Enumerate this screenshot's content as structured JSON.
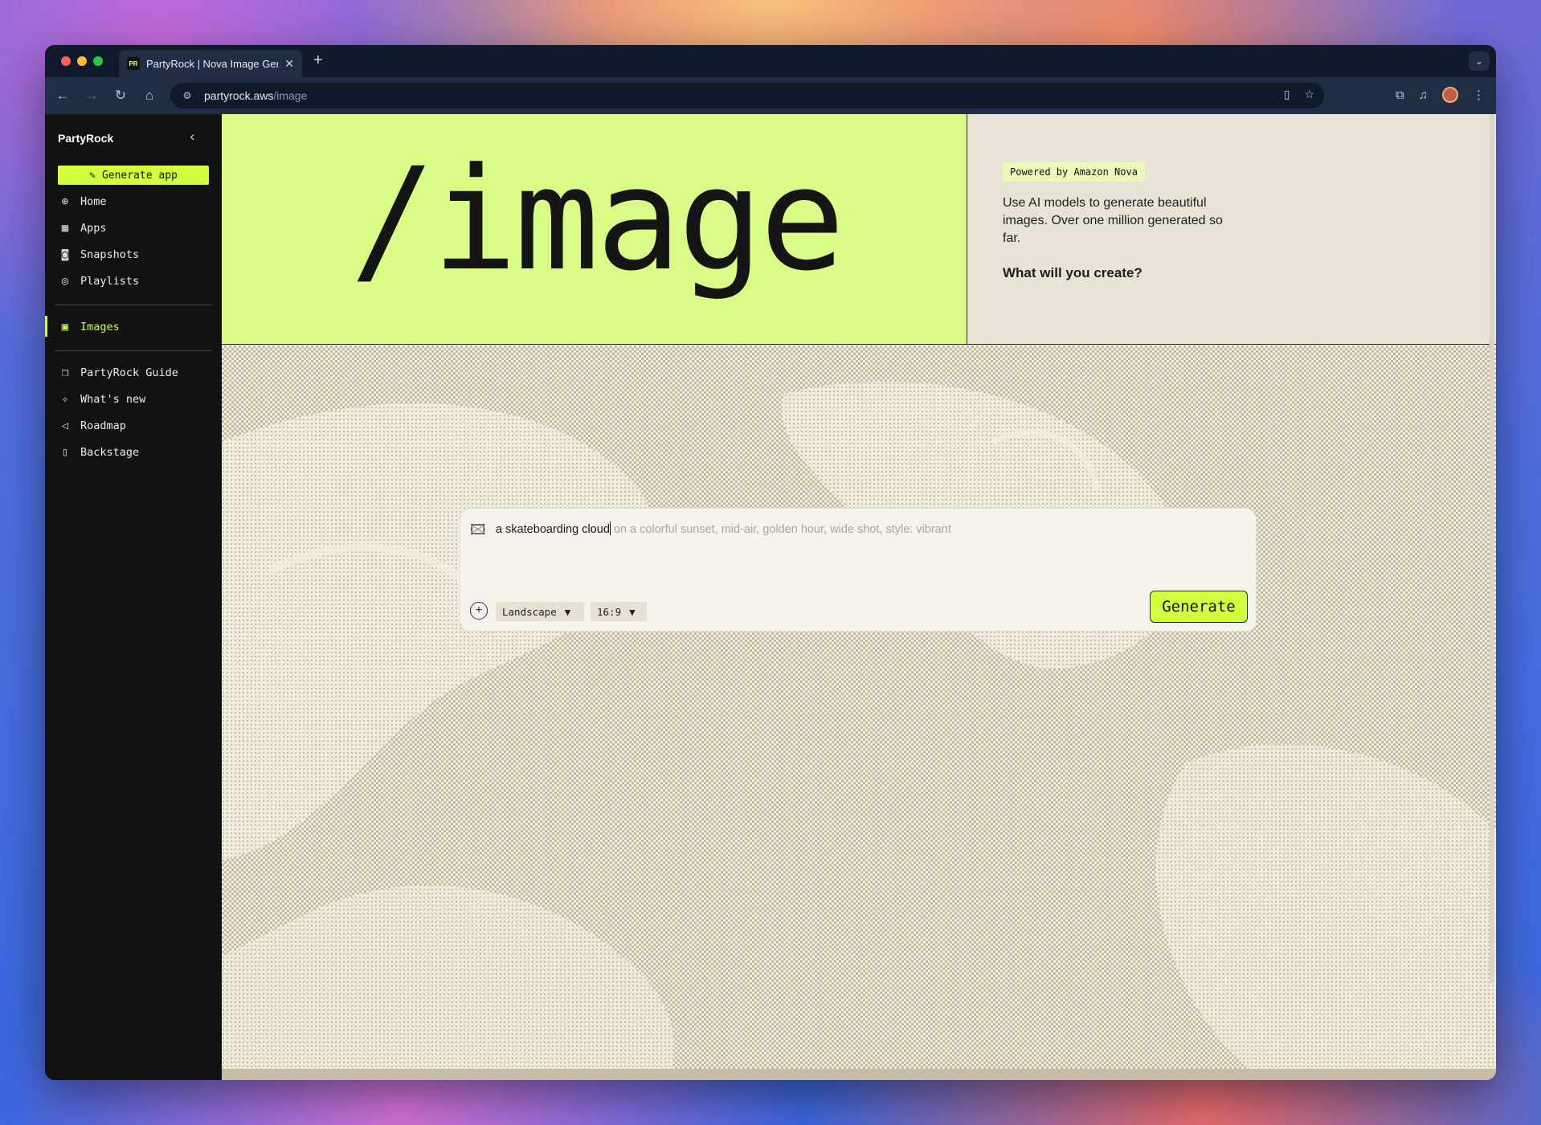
{
  "browser": {
    "tab_title": "PartyRock | Nova Image Generator",
    "favicon_text": "PR",
    "url_host": "partyrock.aws",
    "url_path": "/image"
  },
  "sidebar": {
    "brand": "PartyRock",
    "generate_app": "Generate app",
    "primary": [
      {
        "label": "Home",
        "icon": "globe-icon"
      },
      {
        "label": "Apps",
        "icon": "layout-icon"
      },
      {
        "label": "Snapshots",
        "icon": "camera-icon"
      },
      {
        "label": "Playlists",
        "icon": "playlist-icon"
      }
    ],
    "active_item": {
      "label": "Images",
      "icon": "image-icon"
    },
    "secondary": [
      {
        "label": "PartyRock Guide",
        "icon": "book-icon"
      },
      {
        "label": "What's new",
        "icon": "sparkle-icon"
      },
      {
        "label": "Roadmap",
        "icon": "megaphone-icon"
      },
      {
        "label": "Backstage",
        "icon": "door-icon"
      }
    ]
  },
  "hero": {
    "title": "/image"
  },
  "info": {
    "badge": "Powered by Amazon Nova",
    "description": "Use AI models to generate beautiful images. Over one million generated so far.",
    "question": "What will you create?"
  },
  "prompt": {
    "value": "a skateboarding cloud",
    "placeholder": "on a colorful sunset, mid-air, golden hour, wide shot, style: vibrant",
    "orientation": "Landscape",
    "ratio": "16:9",
    "generate_label": "Generate"
  },
  "colors": {
    "accent": "#d2ff3e",
    "hero_bg": "#d9fc86",
    "sidebar_bg": "#121212",
    "active_nav": "#c9ff3a"
  }
}
